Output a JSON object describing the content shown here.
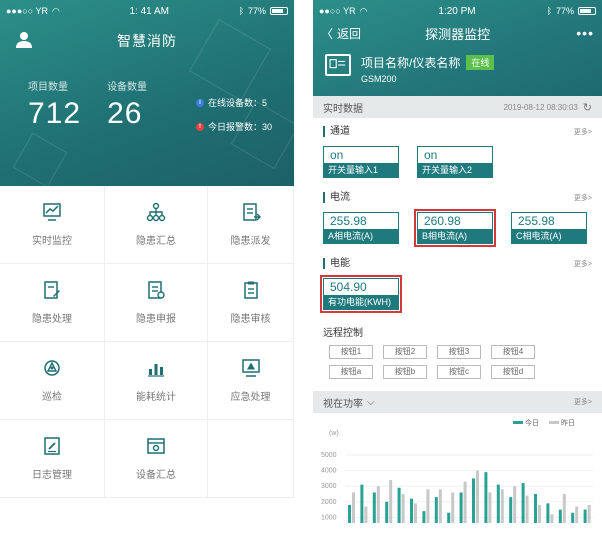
{
  "left": {
    "status": {
      "carrier": "●●●○○ YR",
      "time": "1: 41 AM",
      "battery": "77%",
      "battery_fraction": 0.77
    },
    "title": "智慧消防",
    "stats": [
      {
        "label": "项目数量",
        "value": "712"
      },
      {
        "label": "设备数量",
        "value": "26"
      }
    ],
    "status_items": [
      {
        "text": "在线设备数：5",
        "color": "#3b7de0",
        "mark": "i"
      },
      {
        "text": "今日报警数：30",
        "color": "#e04343",
        "mark": "!"
      }
    ],
    "grid": [
      {
        "label": "实时监控",
        "icon": "monitor-chart-icon"
      },
      {
        "label": "隐患汇总",
        "icon": "hierarchy-icon"
      },
      {
        "label": "隐患派发",
        "icon": "dispatch-doc-icon"
      },
      {
        "label": "隐患处理",
        "icon": "edit-doc-icon"
      },
      {
        "label": "隐患申报",
        "icon": "report-doc-icon"
      },
      {
        "label": "隐患审核",
        "icon": "clipboard-icon"
      },
      {
        "label": "巡检",
        "icon": "patrol-icon"
      },
      {
        "label": "能耗统计",
        "icon": "bar-chart-icon"
      },
      {
        "label": "应急处理",
        "icon": "alert-monitor-icon"
      },
      {
        "label": "日志管理",
        "icon": "log-icon"
      },
      {
        "label": "设备汇总",
        "icon": "device-box-icon"
      }
    ]
  },
  "right": {
    "status": {
      "carrier": "●●○○ YR",
      "time": "1:20 PM",
      "battery": "77%",
      "battery_fraction": 0.77
    },
    "nav": {
      "back": "返回",
      "title": "探测器监控",
      "more": "•••"
    },
    "device": {
      "name": "项目名称/仪表名称",
      "online": "在线",
      "model": "GSM200"
    },
    "realtime": {
      "label": "实时数据",
      "timestamp": "2019-08-12 08:30:03"
    },
    "channel": {
      "title": "通道",
      "more": "更多>",
      "items": [
        {
          "value": "on",
          "label": "开关量输入1"
        },
        {
          "value": "on",
          "label": "开关量输入2"
        }
      ]
    },
    "current": {
      "title": "电流",
      "more": "更多>",
      "items": [
        {
          "value": "255.98",
          "label": "A相电流(A)"
        },
        {
          "value": "260.98",
          "label": "B相电流(A)",
          "highlight": true
        },
        {
          "value": "255.98",
          "label": "C相电流(A)"
        }
      ]
    },
    "energy": {
      "title": "电能",
      "more": "更多>",
      "items": [
        {
          "value": "504.90",
          "label": "有功电能(KWH)",
          "highlight": true
        }
      ]
    },
    "remote": {
      "title": "远程控制",
      "row1": [
        "按钮1",
        "按钮2",
        "按钮3",
        "按钮4"
      ],
      "row2": [
        "按钮a",
        "按钮b",
        "按钮c",
        "按钮d"
      ]
    },
    "power": {
      "title": "视在功率",
      "more": "更多>"
    }
  },
  "chart_data": {
    "type": "bar",
    "ylabel": "(w)",
    "ylim": [
      0,
      5000
    ],
    "y_ticks": [
      "5000",
      "4000",
      "3000",
      "2000",
      "1000"
    ],
    "legend_position": "top-right",
    "series": [
      {
        "name": "今日",
        "color": "#2aa195",
        "values": [
          1800,
          3100,
          2600,
          2000,
          2900,
          2200,
          1400,
          2300,
          1300,
          2600,
          3500,
          3900,
          3100,
          2300,
          3200,
          2500,
          1900,
          1500,
          1300,
          1500
        ]
      },
      {
        "name": "昨日",
        "color": "#c8c8c8",
        "values": [
          2600,
          1700,
          3000,
          3400,
          2500,
          1900,
          2800,
          2800,
          2600,
          3300,
          4000,
          2600,
          2800,
          3000,
          2400,
          1800,
          1200,
          2500,
          1700,
          1800
        ]
      }
    ]
  }
}
